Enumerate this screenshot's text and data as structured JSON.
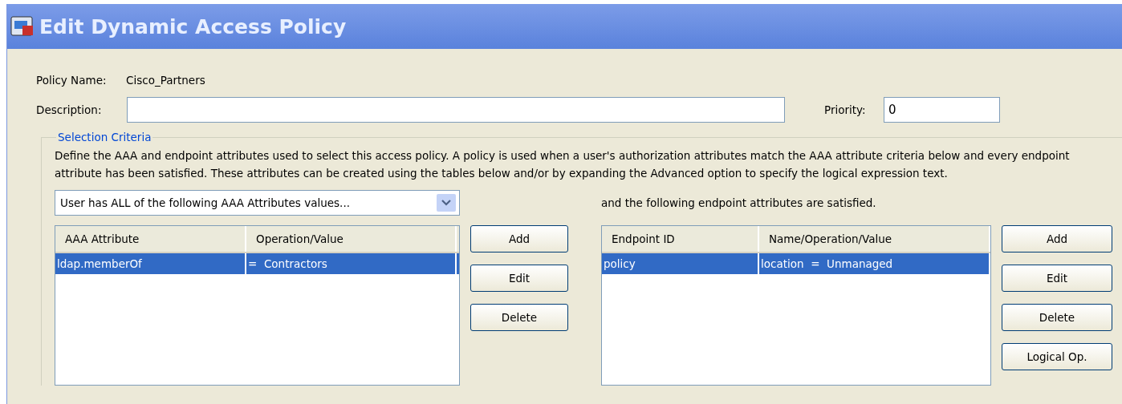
{
  "window": {
    "title": "Edit Dynamic Access Policy"
  },
  "policy_name": {
    "label": "Policy Name:",
    "value": "Cisco_Partners"
  },
  "description": {
    "label": "Description:"
  },
  "priority": {
    "label": "Priority:",
    "value": "0"
  },
  "selection_criteria": {
    "legend": "Selection Criteria",
    "text": "Define the AAA and endpoint attributes used to select this access policy. A policy is used when a user's authorization attributes match the AAA attribute criteria below and every endpoint attribute has been satisfied. These attributes can be created using the tables below and/or by expanding the Advanced option to specify the logical expression text.",
    "aaa_dropdown": {
      "value": "User has ALL of the following AAA Attributes values..."
    },
    "aaa_table": {
      "columns": [
        "AAA Attribute",
        "Operation/Value"
      ],
      "rows": [
        {
          "cells": [
            "ldap.memberOf",
            "=  Contractors"
          ],
          "selected": true
        }
      ]
    },
    "aaa_buttons": [
      "Add",
      "Edit",
      "Delete"
    ],
    "endpoint_caption": "and the following endpoint attributes are satisfied.",
    "endpoint_table": {
      "columns": [
        "Endpoint ID",
        "Name/Operation/Value"
      ],
      "rows": [
        {
          "cells": [
            "policy",
            "location  =  Unmanaged"
          ],
          "selected": true
        }
      ]
    },
    "endpoint_buttons": [
      "Add",
      "Edit",
      "Delete",
      "Logical Op."
    ]
  }
}
